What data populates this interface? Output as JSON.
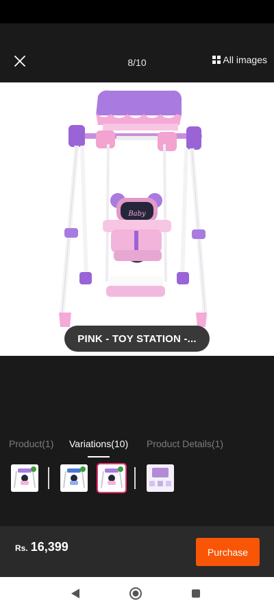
{
  "header": {
    "counter": "8/10",
    "all_images_label": "All images",
    "close_icon": "close-icon",
    "grid_icon": "grid-icon"
  },
  "image": {
    "caption": "PINK - TOY STATION -..."
  },
  "tabs": [
    {
      "label": "Product(1)",
      "active": false
    },
    {
      "label": "Variations(10)",
      "active": true
    },
    {
      "label": "Product Details(1)",
      "active": false
    }
  ],
  "thumbnails": [
    {
      "name": "variation-thumbnail-1",
      "selected": false
    },
    {
      "name": "variation-thumbnail-2",
      "selected": false
    },
    {
      "name": "variation-thumbnail-3",
      "selected": true
    },
    {
      "name": "variation-thumbnail-4",
      "selected": false
    }
  ],
  "footer": {
    "currency": "Rs.",
    "price": "16,399",
    "purchase_label": "Purchase"
  },
  "colors": {
    "accent": "#f85606",
    "selected_outline": "#e8336d",
    "background": "#1a1a1a"
  },
  "nav_icons": [
    "back-icon",
    "home-icon",
    "recents-icon"
  ]
}
